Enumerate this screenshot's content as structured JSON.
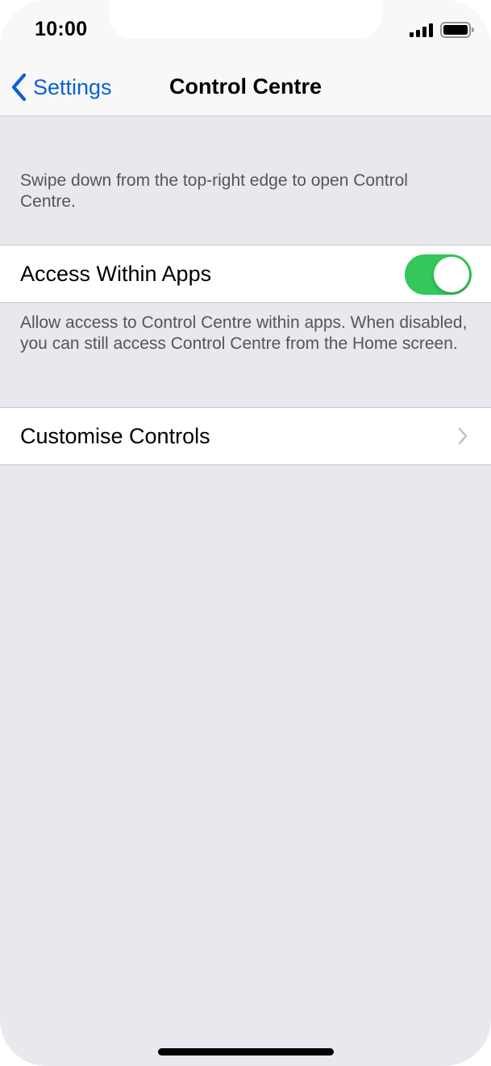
{
  "status_bar": {
    "time": "10:00",
    "signal_icon": "cellular-signal-icon",
    "battery_icon": "battery-icon"
  },
  "nav": {
    "back_label": "Settings",
    "back_icon": "chevron-left-icon",
    "title": "Control Centre"
  },
  "intro_text": "Swipe down from the top-right edge to open Control Centre.",
  "access_within_apps": {
    "label": "Access Within Apps",
    "enabled": true,
    "footer": "Allow access to Control Centre within apps. When disabled, you can still access Control Centre from the Home screen."
  },
  "customise_controls": {
    "label": "Customise Controls",
    "chevron_icon": "chevron-right-icon"
  },
  "colors": {
    "accent": "#0a60d6",
    "toggle_on": "#34c759",
    "background": "#e9e8ee",
    "footnote_text": "#55555b"
  }
}
